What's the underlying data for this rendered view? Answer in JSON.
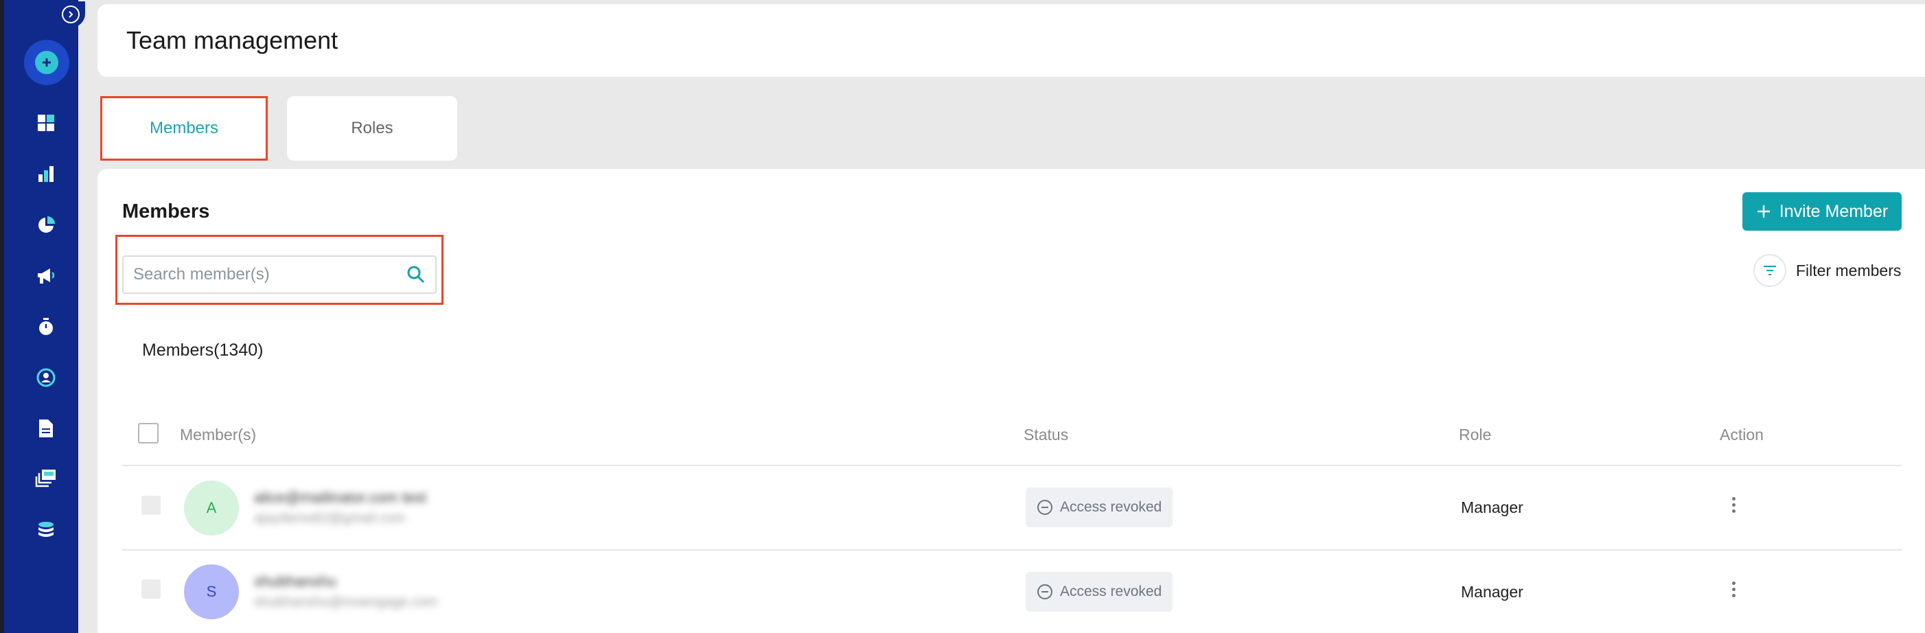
{
  "colors": {
    "sidebar": "#0f2a8a",
    "accent": "#10a2ad",
    "highlight": "#e8452c"
  },
  "sidebar": {
    "items": [
      {
        "icon": "dashboard-icon"
      },
      {
        "icon": "bar-chart-icon"
      },
      {
        "icon": "pie-chart-icon"
      },
      {
        "icon": "megaphone-icon"
      },
      {
        "icon": "stopwatch-icon"
      },
      {
        "icon": "user-target-icon"
      },
      {
        "icon": "document-icon"
      },
      {
        "icon": "stacked-cards-icon"
      },
      {
        "icon": "database-icon"
      }
    ]
  },
  "header": {
    "title": "Team management"
  },
  "tabs": [
    {
      "label": "Members",
      "active": true
    },
    {
      "label": "Roles",
      "active": false
    }
  ],
  "members_section": {
    "title": "Members",
    "invite_label": "Invite Member",
    "search_placeholder": "Search member(s)",
    "filter_label": "Filter members",
    "count_label": "Members(1340)"
  },
  "table": {
    "columns": [
      "Member(s)",
      "Status",
      "Role",
      "Action"
    ],
    "rows": [
      {
        "initial": "A",
        "name": "alice@mailinator.com test",
        "email": "ajaydemo62@gmail.com",
        "status": "Access revoked",
        "role": "Manager"
      },
      {
        "initial": "S",
        "name": "shubhanshu",
        "email": "shubhanshu@moengage.com",
        "status": "Access revoked",
        "role": "Manager"
      }
    ]
  }
}
